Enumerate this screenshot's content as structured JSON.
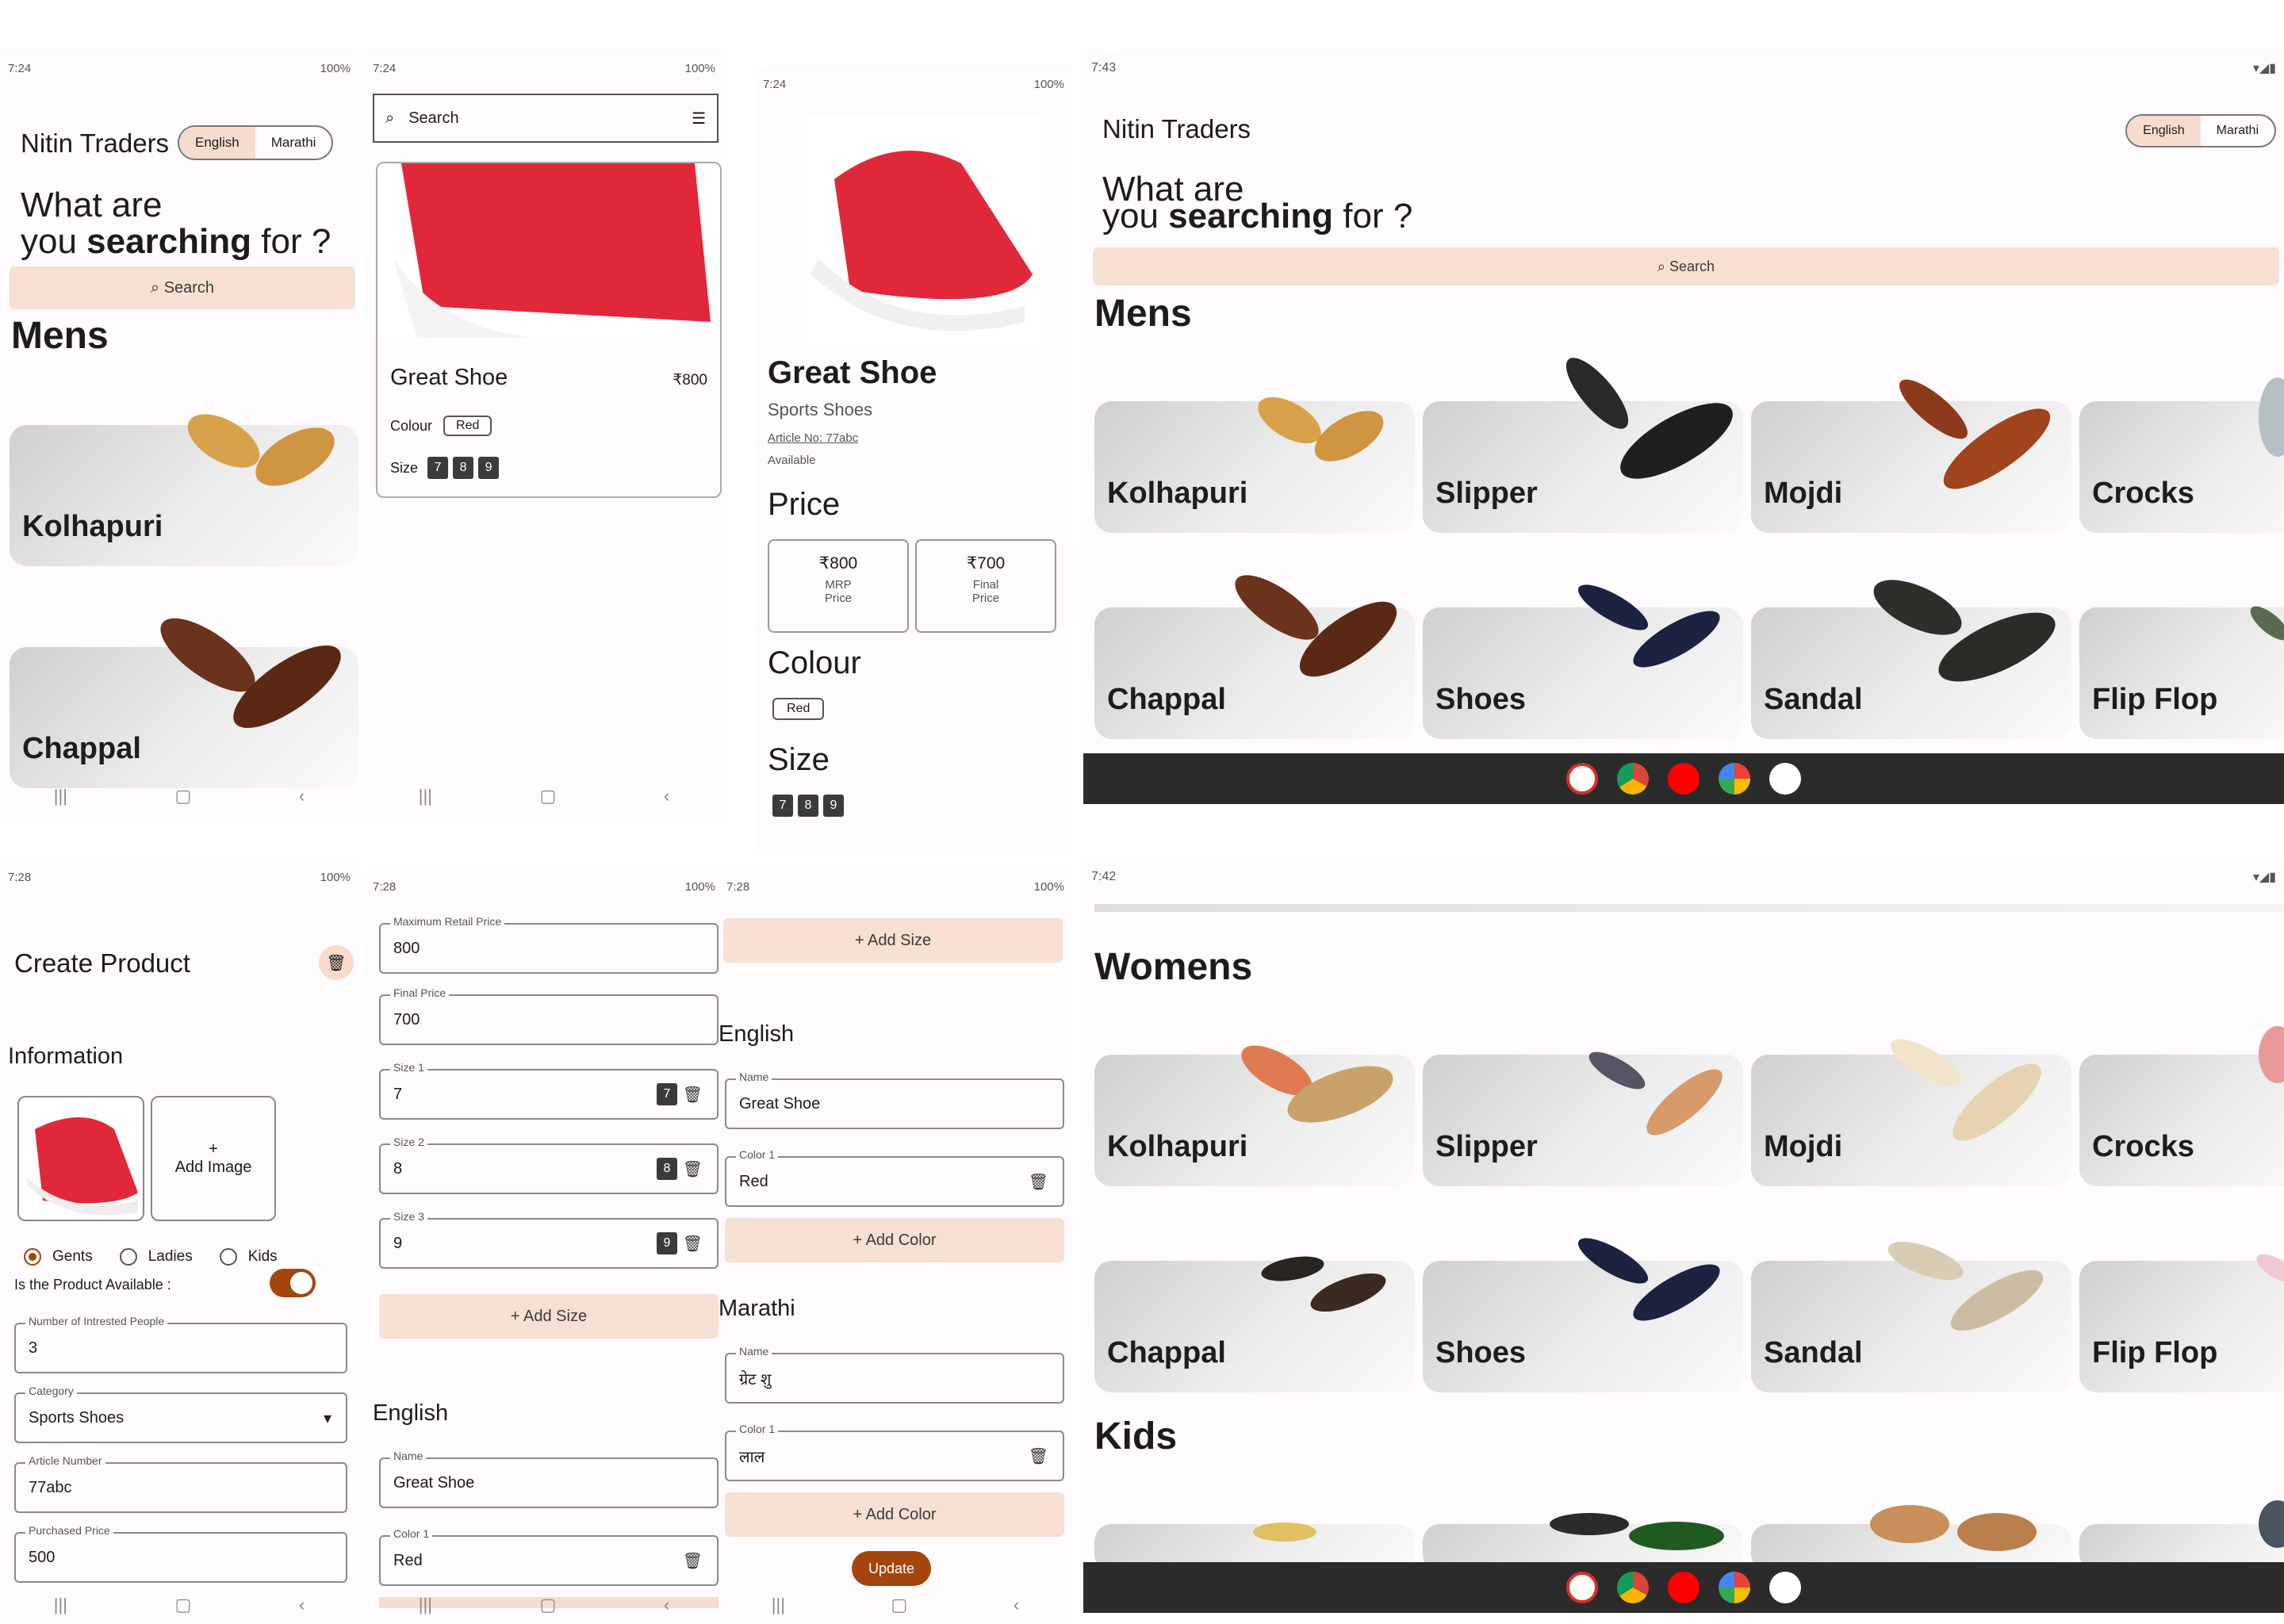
{
  "p1": {
    "time": "7:24",
    "battery": "100%",
    "title": "Nitin Traders",
    "lang_en": "English",
    "lang_mr": "Marathi",
    "heading1": "What are",
    "heading2a": "you ",
    "heading2b": "searching",
    "heading2c": " for ?",
    "search": "Search",
    "section": "Mens",
    "cards": [
      "Kolhapuri",
      "Chappal"
    ]
  },
  "p2": {
    "time": "7:24",
    "battery": "100%",
    "search_placeholder": "Search",
    "product_name": "Great Shoe",
    "price": "₹800",
    "colour_label": "Colour",
    "colour": "Red",
    "size_label": "Size",
    "sizes": [
      "7",
      "8",
      "9"
    ]
  },
  "p3": {
    "time": "7:24",
    "battery": "100%",
    "name": "Great Shoe",
    "category": "Sports Shoes",
    "article": "Article No: 77abc",
    "availability": "Available",
    "price_heading": "Price",
    "mrp": "₹800",
    "mrp_label1": "MRP",
    "mrp_label2": "Price",
    "final": "₹700",
    "final_label1": "Final",
    "final_label2": "Price",
    "colour_heading": "Colour",
    "colour": "Red",
    "size_heading": "Size",
    "sizes": [
      "7",
      "8",
      "9"
    ]
  },
  "tab1": {
    "time": "7:43",
    "title": "Nitin Traders",
    "lang_en": "English",
    "lang_mr": "Marathi",
    "heading1": "What are",
    "heading2a": "you ",
    "heading2b": "searching",
    "heading2c": " for ?",
    "search": "Search",
    "section": "Mens",
    "cards": [
      "Kolhapuri",
      "Slipper",
      "Mojdi",
      "Crocks",
      "Chappal",
      "Shoes",
      "Sandal",
      "Flip Flop"
    ]
  },
  "p4": {
    "time": "7:28",
    "battery": "100%",
    "title": "Create Product",
    "info": "Information",
    "add_image_plus": "+",
    "add_image": "Add Image",
    "radio": [
      "Gents",
      "Ladies",
      "Kids"
    ],
    "available_label": "Is the Product Available :",
    "interested_label": "Number of Intrested People",
    "interested": "3",
    "category_label": "Category",
    "category": "Sports Shoes",
    "article_label": "Article Number",
    "article": "77abc",
    "purchased_label": "Purchased Price",
    "purchased": "500"
  },
  "p5": {
    "time": "7:28",
    "battery": "100%",
    "mrp_label": "Maximum Retail Price",
    "mrp": "800",
    "final_label": "Final Price",
    "final": "700",
    "size1_label": "Size 1",
    "size1": "7",
    "size2_label": "Size 2",
    "size2": "8",
    "size3_label": "Size 3",
    "size3": "9",
    "add_size": "+ Add Size",
    "english": "English",
    "name_label": "Name",
    "name": "Great Shoe",
    "color1_label": "Color 1",
    "color1": "Red"
  },
  "p6": {
    "time": "7:28",
    "battery": "100%",
    "add_size": "+ Add Size",
    "english": "English",
    "name_label": "Name",
    "name": "Great Shoe",
    "color1_label": "Color 1",
    "color1": "Red",
    "add_color": "+ Add Color",
    "marathi": "Marathi",
    "mr_name_label": "Name",
    "mr_name": "ग्रेट शु",
    "mr_color1_label": "Color 1",
    "mr_color1": "लाल",
    "add_color2": "+ Add Color",
    "update": "Update"
  },
  "tab2": {
    "time": "7:42",
    "womens": "Womens",
    "cards": [
      "Kolhapuri",
      "Slipper",
      "Mojdi",
      "Crocks",
      "Chappal",
      "Shoes",
      "Sandal",
      "Flip Flop"
    ],
    "kids": "Kids"
  },
  "colors": {
    "accent": "#f6dccf",
    "brand_button": "#a3450c",
    "shoe_red": "#e0283a",
    "toggle": "#a3450c"
  }
}
